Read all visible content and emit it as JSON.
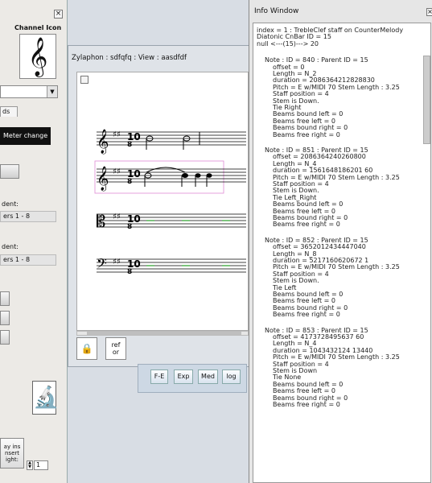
{
  "channel_panel": {
    "title": "Channel Icon",
    "close_label": "×",
    "clef_glyph": "𝄞",
    "tab_label": "ds",
    "meter_button_label": "Meter change",
    "label_1": "dent:",
    "field_1_value": "ers 1 - 8",
    "label_2": "dent:",
    "field_2_value": "ers 1 - 8",
    "microscope_glyph": "🔬",
    "insert_label_1": "ay ins",
    "insert_label_2": "nsert",
    "insert_label_3": "ight:",
    "spin_up": "▲",
    "spin_down": "▼",
    "spin_value": "1"
  },
  "music_window": {
    "title": "Zylaphon : sdfqfq : View : aasdfdf",
    "lock_glyph": "🔒",
    "ref_line_1": "ref",
    "ref_line_2": "or"
  },
  "toolbar": {
    "btn_fe": "F-E",
    "btn_exp": "Exp",
    "btn_med": "Med",
    "btn_log": "log"
  },
  "info_window": {
    "title": "Info Window",
    "close_label": "×",
    "lines": [
      "index = 1 : TrebleClef staff on CounterMelody",
      "Diatonic CnBar ID = 15",
      "null <---(15)---> 20",
      "Note : ID = 840 : Parent ID = 15",
      "offset = 0",
      "Length = N_2",
      "duration = 2086364212828830",
      "Pitch = E  w/MIDI 70 Stem Length :  3.25",
      "Staff position = 4",
      "Stem is Down.",
      "Tie Right",
      "Beams bound left = 0",
      "Beams free left = 0",
      "Beams bound right = 0",
      "Beams free right = 0",
      "Note : ID = 851 : Parent ID = 15",
      "offset = 2086364240260800",
      "Length = N_4",
      "duration = 1561648186201 60",
      "Pitch = E  w/MIDI 70 Stem Length :  3.25",
      "Staff position = 4",
      "Stem is Down.",
      "Tie Left_Right",
      "Beams bound left = 0",
      "Beams free left = 0",
      "Beams bound right = 0",
      "Beams free right = 0",
      "Note : ID = 852 : Parent ID = 15",
      "offset = 3652012434447040",
      "Length = N_8",
      "duration = 5217160620672 1",
      "Pitch = E  w/MIDI 70 Stem Length :  3.25",
      "Staff position = 4",
      "Stem is Down.",
      "Tie Left",
      "Beams bound left = 0",
      "Beams free left = 0",
      "Beams bound right = 0",
      "Beams free right = 0",
      "Note : ID = 853 : Parent ID = 15",
      "offset = 4173728495637 60",
      "Length = N_4",
      "duration = 1043432124 13440",
      "Pitch = E  w/MIDI 70 Stem Length :  3.25",
      "Staff position = 4",
      "Stem is Down",
      "Tie None",
      "Beams bound left = 0",
      "Beams free left = 0",
      "Beams bound right = 0",
      "Beams free right = 0"
    ]
  }
}
